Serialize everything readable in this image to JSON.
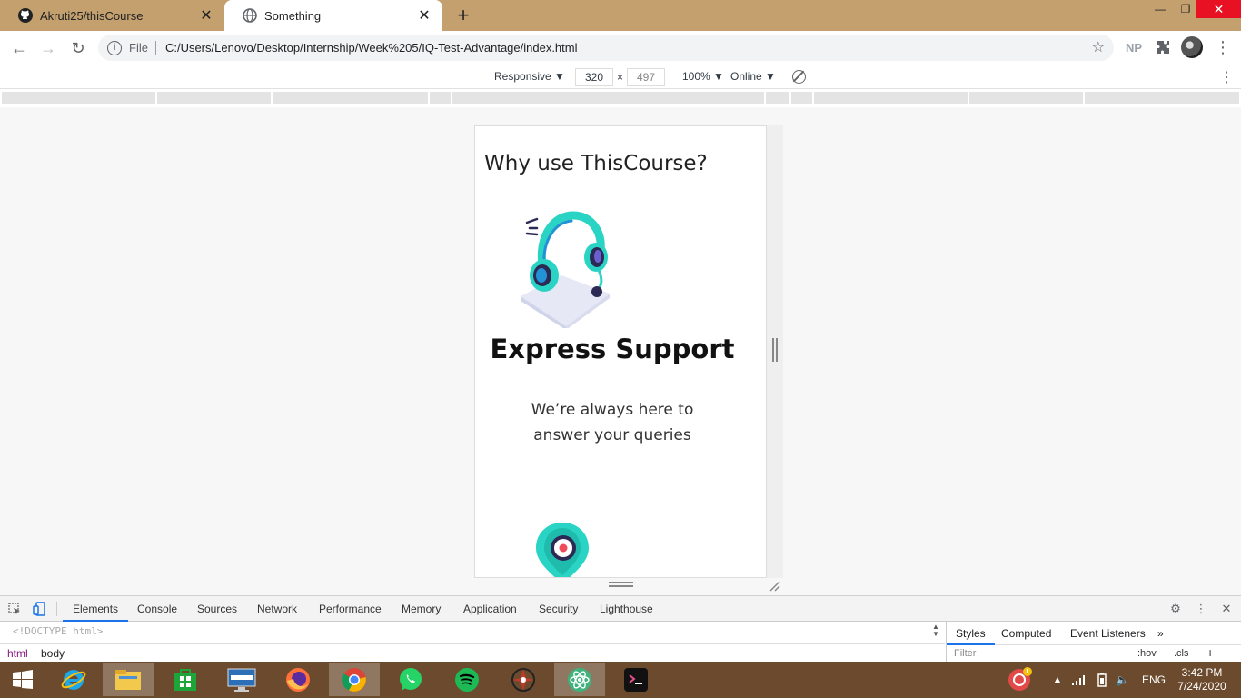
{
  "browser": {
    "tabs": [
      {
        "title": "Akruti25/thisCourse",
        "active": false
      },
      {
        "title": "Something",
        "active": true
      }
    ],
    "url_scheme": "File",
    "url": "C:/Users/Lenovo/Desktop/Internship/Week%205/IQ-Test-Advantage/index.html",
    "profile_initials": "NP"
  },
  "device_toolbar": {
    "device": "Responsive ▼",
    "width": "320",
    "height": "497",
    "times": "×",
    "zoom": "100% ▼",
    "network": "Online ▼"
  },
  "page": {
    "heading": "Why use ThisCourse?",
    "feature_title": "Express Support",
    "feature_desc": "We’re always here to answer your queries"
  },
  "devtools": {
    "tabs": [
      "Elements",
      "Console",
      "Sources",
      "Network",
      "Performance",
      "Memory",
      "Application",
      "Security",
      "Lighthouse"
    ],
    "active_tab": "Elements",
    "doctype": "<!DOCTYPE html>",
    "breadcrumbs": [
      "html",
      "body"
    ],
    "side_tabs": [
      "Styles",
      "Computed",
      "Event Listeners",
      "»"
    ],
    "filter_placeholder": "Filter",
    "hov": ":hov",
    "cls": ".cls",
    "add": "+"
  },
  "taskbar": {
    "language": "ENG",
    "time": "3:42 PM",
    "date": "7/24/2020"
  },
  "colors": {
    "tabstrip": "#c3a06d",
    "taskbar": "#6b4a2d",
    "accent_teal": "#2ad4c4",
    "accent_blue": "#1a73e8",
    "dark_navy": "#2c2a55"
  }
}
